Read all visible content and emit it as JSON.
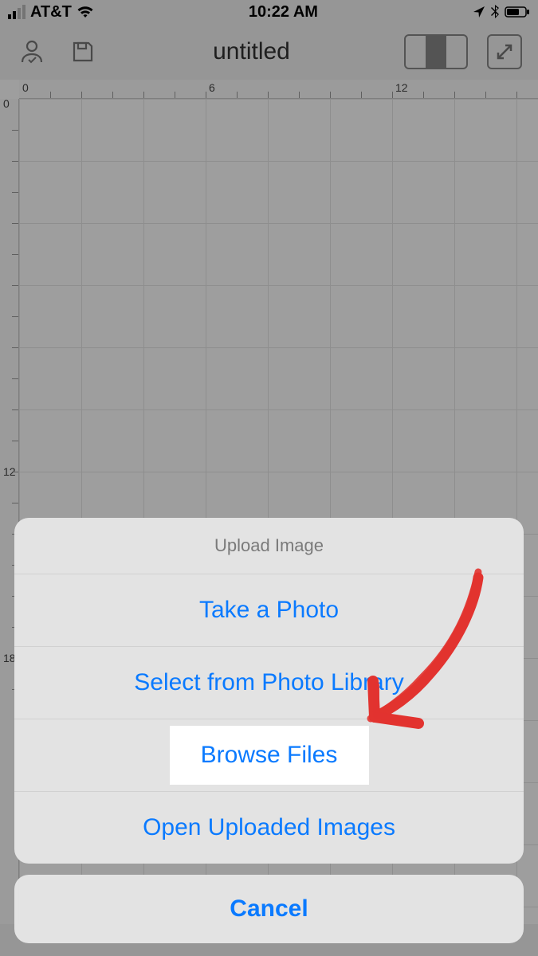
{
  "status": {
    "carrier": "AT&T",
    "time": "10:22 AM"
  },
  "toolbar": {
    "title": "untitled"
  },
  "ruler": {
    "h0": "0",
    "h6": "6",
    "h12": "12",
    "v0": "0",
    "v12": "12",
    "v18": "18"
  },
  "sheet": {
    "title": "Upload Image",
    "opt1": "Take a Photo",
    "opt2": "Select from Photo Library",
    "opt3": "Browse Files",
    "opt4": "Open Uploaded Images",
    "cancel": "Cancel"
  }
}
